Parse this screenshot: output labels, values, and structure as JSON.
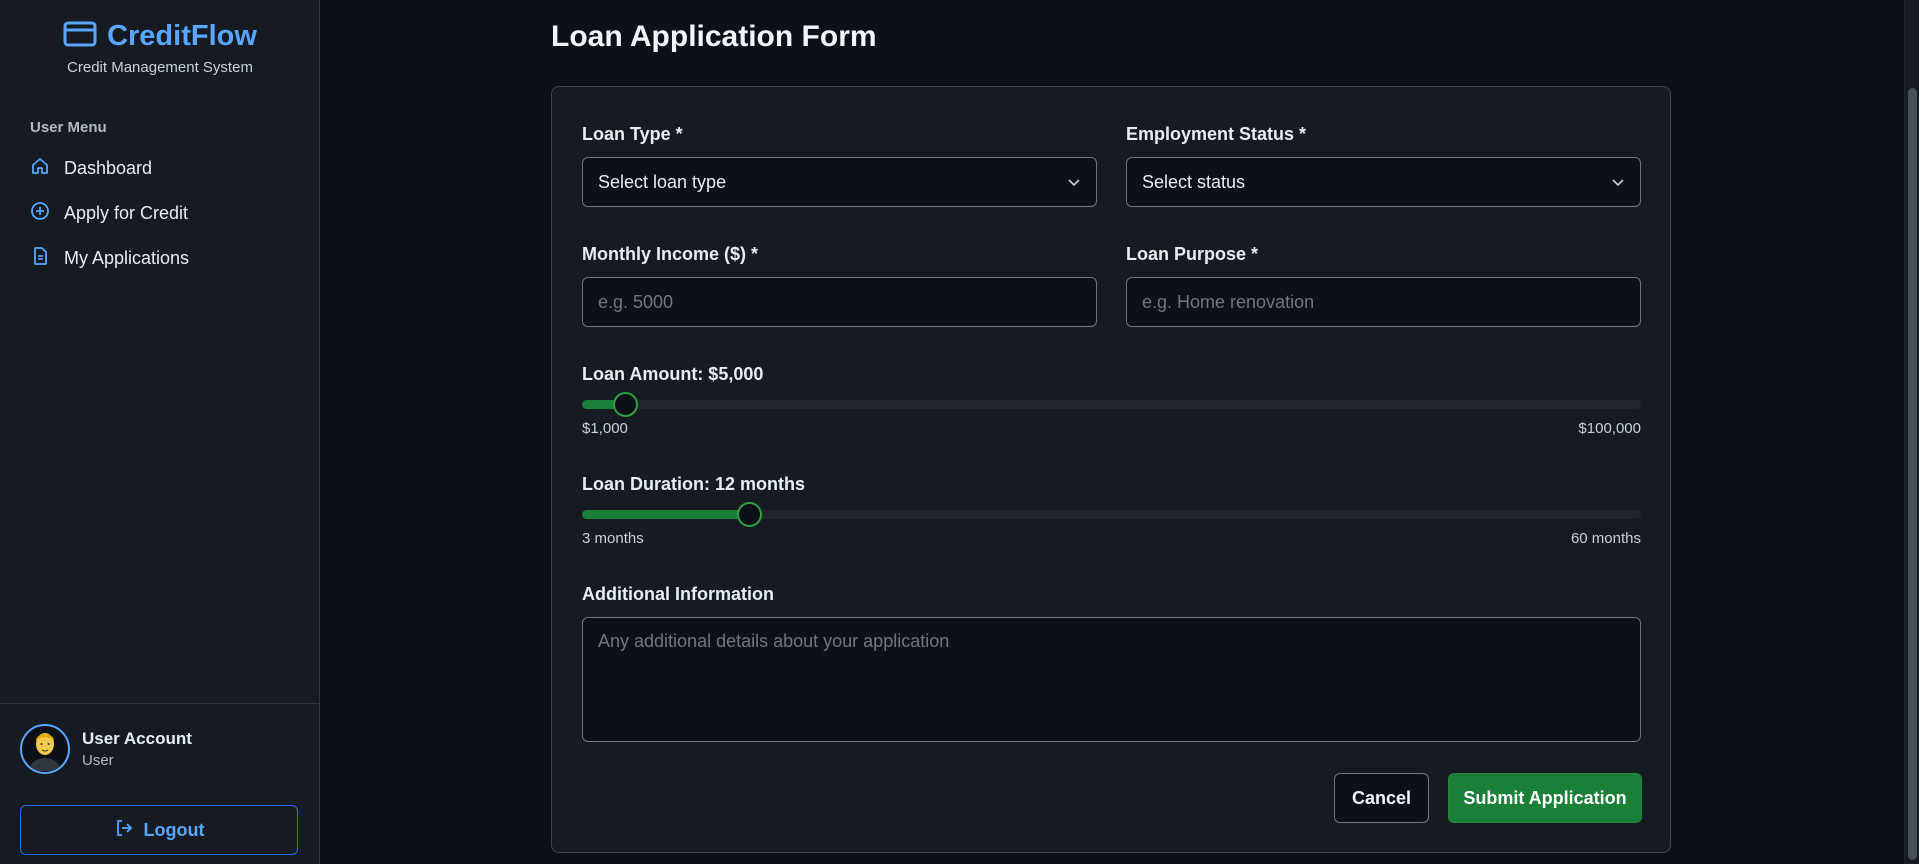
{
  "brand": {
    "name": "CreditFlow",
    "subtitle": "Credit Management System",
    "icon": "credit-card-icon",
    "accent_color": "#58a6ff"
  },
  "sidebar": {
    "menu_heading": "User Menu",
    "items": [
      {
        "label": "Dashboard",
        "icon": "home-icon"
      },
      {
        "label": "Apply for Credit",
        "icon": "plus-circle-icon"
      },
      {
        "label": "My Applications",
        "icon": "document-icon"
      }
    ]
  },
  "user": {
    "name": "User Account",
    "role": "User",
    "avatar_icon": "avatar-icon"
  },
  "logout": {
    "label": "Logout",
    "icon": "logout-icon"
  },
  "page": {
    "title": "Loan Application Form"
  },
  "form": {
    "loan_type": {
      "label": "Loan Type *",
      "value": "Select loan type"
    },
    "employment_status": {
      "label": "Employment Status *",
      "value": "Select status"
    },
    "monthly_income": {
      "label": "Monthly Income ($) *",
      "placeholder": "e.g. 5000"
    },
    "loan_purpose": {
      "label": "Loan Purpose *",
      "placeholder": "e.g. Home renovation"
    },
    "loan_amount": {
      "label": "Loan Amount: $5,000",
      "value": 5000,
      "min": 1000,
      "max": 100000,
      "min_label": "$1,000",
      "max_label": "$100,000"
    },
    "loan_duration": {
      "label": "Loan Duration: 12 months",
      "value": 12,
      "min": 3,
      "max": 60,
      "min_label": "3 months",
      "max_label": "60 months"
    },
    "additional_info": {
      "label": "Additional Information",
      "placeholder": "Any additional details about your application"
    },
    "cancel_label": "Cancel",
    "submit_label": "Submit Application",
    "submit_color": "#1a7f37"
  }
}
